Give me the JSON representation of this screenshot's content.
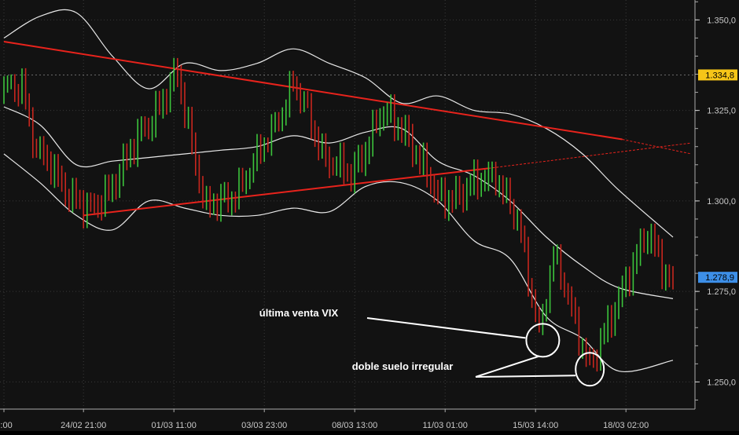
{
  "chart_data": {
    "type": "line",
    "subtype": "candlestick-bars with bollinger bands and trendlines",
    "title": "",
    "xlabel": "",
    "ylabel": "",
    "ylim": [
      1.2425,
      1.3555
    ],
    "grid": true,
    "x_ticks": [
      {
        "index": 0,
        "label": "2:00"
      },
      {
        "index": 22,
        "label": "24/02 21:00"
      },
      {
        "index": 47,
        "label": "01/03 11:00"
      },
      {
        "index": 72,
        "label": "03/03 23:00"
      },
      {
        "index": 97,
        "label": "08/03 13:00"
      },
      {
        "index": 122,
        "label": "11/03 01:00"
      },
      {
        "index": 147,
        "label": "15/03 14:00"
      },
      {
        "index": 172,
        "label": "18/03 02:00"
      }
    ],
    "y_ticks": [
      1.35,
      1.325,
      1.3,
      1.275,
      1.25
    ],
    "y_tick_labels": [
      "1.350,0",
      "1.325,0",
      "1.300,0",
      "1.275,0",
      "1.250,0"
    ],
    "reference_levels": [
      {
        "value": 1.3348,
        "label": "1.334,8",
        "color": "#f5c518"
      },
      {
        "value": 1.2789,
        "label": "1.278,9",
        "color": "#3d8fe8"
      }
    ],
    "price_path": [
      [
        0,
        1.33
      ],
      [
        5,
        1.333
      ],
      [
        9,
        1.314
      ],
      [
        16,
        1.305
      ],
      [
        24,
        1.296
      ],
      [
        34,
        1.311
      ],
      [
        40,
        1.322
      ],
      [
        48,
        1.334
      ],
      [
        56,
        1.298
      ],
      [
        62,
        1.3
      ],
      [
        72,
        1.315
      ],
      [
        80,
        1.333
      ],
      [
        88,
        1.314
      ],
      [
        96,
        1.306
      ],
      [
        104,
        1.324
      ],
      [
        112,
        1.318
      ],
      [
        120,
        1.3
      ],
      [
        130,
        1.304
      ],
      [
        136,
        1.308
      ],
      [
        142,
        1.294
      ],
      [
        148,
        1.265
      ],
      [
        152,
        1.285
      ],
      [
        158,
        1.267
      ],
      [
        162,
        1.255
      ],
      [
        166,
        1.262
      ],
      [
        172,
        1.279
      ],
      [
        178,
        1.29
      ],
      [
        185,
        1.277
      ]
    ],
    "bollinger": {
      "middle": [
        [
          0,
          1.326
        ],
        [
          10,
          1.321
        ],
        [
          20,
          1.31
        ],
        [
          30,
          1.311
        ],
        [
          40,
          1.312
        ],
        [
          50,
          1.313
        ],
        [
          60,
          1.314
        ],
        [
          70,
          1.315
        ],
        [
          80,
          1.318
        ],
        [
          90,
          1.316
        ],
        [
          100,
          1.319
        ],
        [
          110,
          1.32
        ],
        [
          120,
          1.311
        ],
        [
          130,
          1.307
        ],
        [
          140,
          1.3
        ],
        [
          150,
          1.29
        ],
        [
          160,
          1.282
        ],
        [
          170,
          1.276
        ],
        [
          185,
          1.273
        ]
      ],
      "upper": [
        [
          0,
          1.345
        ],
        [
          10,
          1.351
        ],
        [
          20,
          1.352
        ],
        [
          30,
          1.34
        ],
        [
          40,
          1.331
        ],
        [
          50,
          1.338
        ],
        [
          60,
          1.336
        ],
        [
          70,
          1.338
        ],
        [
          80,
          1.342
        ],
        [
          90,
          1.338
        ],
        [
          100,
          1.334
        ],
        [
          110,
          1.327
        ],
        [
          120,
          1.329
        ],
        [
          130,
          1.325
        ],
        [
          140,
          1.324
        ],
        [
          150,
          1.32
        ],
        [
          160,
          1.313
        ],
        [
          170,
          1.303
        ],
        [
          185,
          1.29
        ]
      ],
      "lower": [
        [
          0,
          1.313
        ],
        [
          10,
          1.305
        ],
        [
          20,
          1.296
        ],
        [
          30,
          1.292
        ],
        [
          40,
          1.3
        ],
        [
          50,
          1.298
        ],
        [
          60,
          1.296
        ],
        [
          70,
          1.296
        ],
        [
          80,
          1.298
        ],
        [
          90,
          1.297
        ],
        [
          100,
          1.304
        ],
        [
          110,
          1.305
        ],
        [
          120,
          1.3
        ],
        [
          130,
          1.289
        ],
        [
          140,
          1.284
        ],
        [
          150,
          1.268
        ],
        [
          160,
          1.262
        ],
        [
          170,
          1.253
        ],
        [
          185,
          1.256
        ]
      ]
    },
    "trendlines": [
      {
        "name": "resistance",
        "from": [
          0,
          1.344
        ],
        "to": [
          171,
          1.317
        ],
        "projection_to": [
          190,
          1.313
        ],
        "color": "#e8231c"
      },
      {
        "name": "support",
        "from": [
          22,
          1.296
        ],
        "to": [
          134,
          1.309
        ],
        "projection_to": [
          190,
          1.316
        ],
        "color": "#e8231c"
      }
    ],
    "annotations": [
      {
        "text": "última venta VIX",
        "target": [
          149,
          1.2615
        ]
      },
      {
        "text": "doble suelo irregular",
        "target": [
          162,
          1.2535
        ]
      }
    ]
  }
}
